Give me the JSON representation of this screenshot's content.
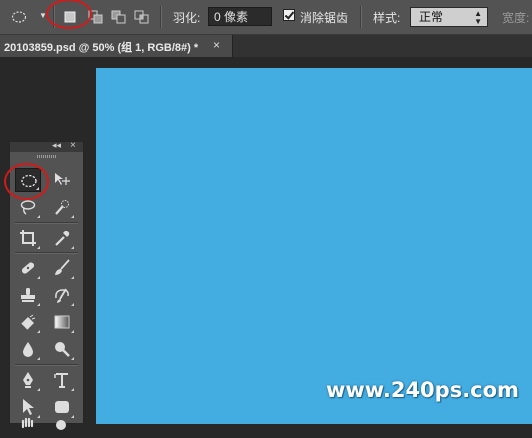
{
  "options_bar": {
    "feather_label": "羽化:",
    "feather_value": "0 像素",
    "antialias_label": "消除锯齿",
    "antialias_checked": true,
    "style_label": "样式:",
    "style_value": "正常",
    "width_label": "宽度:"
  },
  "tab": {
    "title": "20103859.psd @ 50% (组 1, RGB/8#) *",
    "close": "×"
  },
  "tool_panel": {
    "collapse": "◂◂",
    "close": "×"
  },
  "canvas": {
    "color": "#43ade1"
  },
  "watermark": "www.240ps.com",
  "highlight_color": "#d21a1a"
}
